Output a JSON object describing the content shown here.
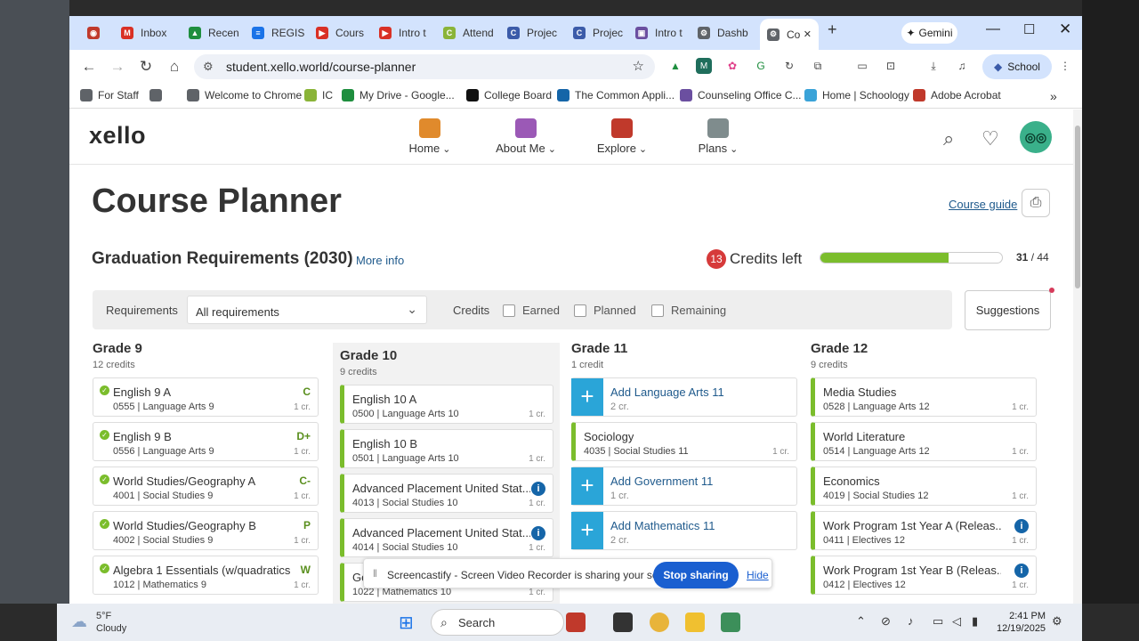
{
  "browser": {
    "tabs": [
      {
        "label": "",
        "color": "#c0392b",
        "glyph": "◉"
      },
      {
        "label": "Inbox",
        "color": "#d93025",
        "glyph": "M"
      },
      {
        "label": "Recen",
        "color": "#1e8e3e",
        "glyph": "▲"
      },
      {
        "label": "REGIS",
        "color": "#1a73e8",
        "glyph": "≡"
      },
      {
        "label": "Cours",
        "color": "#d93025",
        "glyph": "▶"
      },
      {
        "label": "Intro t",
        "color": "#d93025",
        "glyph": "▶"
      },
      {
        "label": "Attend",
        "color": "#8ab438",
        "glyph": "C"
      },
      {
        "label": "Projec",
        "color": "#3b5ba9",
        "glyph": "C"
      },
      {
        "label": "Projec",
        "color": "#3b5ba9",
        "glyph": "C"
      },
      {
        "label": "Intro t",
        "color": "#6b4fa0",
        "glyph": "▣"
      },
      {
        "label": "Dashb",
        "color": "#5f6368",
        "glyph": "⚙"
      },
      {
        "label": "Co",
        "color": "#5f6368",
        "glyph": "⚙"
      }
    ],
    "gemini_label": "Gemini",
    "url": "student.xello.world/course-planner",
    "profile_label": "School",
    "bookmarks": [
      {
        "label": "For Staff",
        "color": "#5f6368"
      },
      {
        "label": "",
        "color": "#5f6368"
      },
      {
        "label": "Welcome to Chrome",
        "color": "#5f6368"
      },
      {
        "label": "IC",
        "color": "#8ab438"
      },
      {
        "label": "My Drive - Google...",
        "color": "#1e8e3e"
      },
      {
        "label": "College Board",
        "color": "#111111"
      },
      {
        "label": "The Common Appli...",
        "color": "#1565a8"
      },
      {
        "label": "Counseling Office C...",
        "color": "#6b4fa0"
      },
      {
        "label": "Home | Schoology",
        "color": "#3aa3d8"
      },
      {
        "label": "Adobe Acrobat",
        "color": "#c0392b"
      }
    ],
    "more_bookmarks": "»"
  },
  "xello": {
    "logo": "xello",
    "nav": [
      {
        "label": "Home",
        "icon": "house-icon",
        "color": "#e08a2c"
      },
      {
        "label": "About Me",
        "icon": "person-icon",
        "color": "#9b59b6"
      },
      {
        "label": "Explore",
        "icon": "rocket-icon",
        "color": "#c0392b"
      },
      {
        "label": "Plans",
        "icon": "clipboard-icon",
        "color": "#7f8c8d"
      }
    ],
    "avatar_glyph": "◎◎"
  },
  "planner": {
    "title": "Course Planner",
    "course_guide": "Course guide",
    "grad_title": "Graduation Requirements (2030)",
    "more_info": "More info",
    "credits_left_num": "13",
    "credits_left_label": "Credits left",
    "progress_earned": "31",
    "progress_total": "/ 44",
    "progress_fraction": 0.7045,
    "filter": {
      "requirements_label": "Requirements",
      "requirements_value": "All requirements",
      "credits_label": "Credits",
      "earned": "Earned",
      "planned": "Planned",
      "remaining": "Remaining"
    },
    "suggestions": "Suggestions"
  },
  "grades": [
    {
      "title": "Grade 9",
      "credits": "12 credits",
      "courses": [
        {
          "name": "English 9 A",
          "code": "0555 | Language Arts 9",
          "credit": "1 cr.",
          "grade": "C",
          "type": "done"
        },
        {
          "name": "English 9 B",
          "code": "0556 | Language Arts 9",
          "credit": "1 cr.",
          "grade": "D+",
          "type": "done"
        },
        {
          "name": "World Studies/Geography A",
          "code": "4001 | Social Studies 9",
          "credit": "1 cr.",
          "grade": "C-",
          "type": "done"
        },
        {
          "name": "World Studies/Geography B",
          "code": "4002 | Social Studies 9",
          "credit": "1 cr.",
          "grade": "P",
          "type": "done"
        },
        {
          "name": "Algebra 1 Essentials (w/quadratics ...",
          "code": "1012 | Mathematics 9",
          "credit": "1 cr.",
          "grade": "W",
          "type": "done"
        }
      ]
    },
    {
      "title": "Grade 10",
      "credits": "9 credits",
      "courses": [
        {
          "name": "English 10 A",
          "code": "0500 | Language Arts 10",
          "credit": "1 cr.",
          "type": "planned"
        },
        {
          "name": "English 10 B",
          "code": "0501 | Language Arts 10",
          "credit": "1 cr.",
          "type": "planned"
        },
        {
          "name": "Advanced Placement United Stat...",
          "code": "4013 | Social Studies 10",
          "credit": "1 cr.",
          "type": "planned-info"
        },
        {
          "name": "Advanced Placement United Stat...",
          "code": "4014 | Social Studies 10",
          "credit": "1 cr.",
          "type": "planned-info"
        },
        {
          "name": "Ge...",
          "code": "1022 | Mathematics 10",
          "credit": "1 cr.",
          "type": "planned"
        }
      ]
    },
    {
      "title": "Grade 11",
      "credits": "1 credit",
      "courses": [
        {
          "name": "Add Language Arts 11",
          "code": "2 cr.",
          "credit": "",
          "type": "add"
        },
        {
          "name": "Sociology",
          "code": "4035 | Social Studies 11",
          "credit": "1 cr.",
          "type": "planned"
        },
        {
          "name": "Add Government 11",
          "code": "1 cr.",
          "credit": "",
          "type": "add"
        },
        {
          "name": "Add Mathematics 11",
          "code": "2 cr.",
          "credit": "",
          "type": "add"
        }
      ]
    },
    {
      "title": "Grade 12",
      "credits": "9 credits",
      "courses": [
        {
          "name": "Media Studies",
          "code": "0528 | Language Arts 12",
          "credit": "1 cr.",
          "type": "planned"
        },
        {
          "name": "World Literature",
          "code": "0514 | Language Arts 12",
          "credit": "1 cr.",
          "type": "planned"
        },
        {
          "name": "Economics",
          "code": "4019 | Social Studies 12",
          "credit": "1 cr.",
          "type": "planned"
        },
        {
          "name": "Work Program 1st Year A (Releas...",
          "code": "0411 | Electives 12",
          "credit": "1 cr.",
          "type": "planned-info"
        },
        {
          "name": "Work Program 1st Year B (Releas...",
          "code": "0412 | Electives 12",
          "credit": "1 cr.",
          "type": "planned-info"
        }
      ]
    }
  ],
  "screenshare": {
    "text": "Screencastify - Screen Video Recorder is sharing your screen.",
    "stop": "Stop sharing",
    "hide": "Hide"
  },
  "taskbar": {
    "temp": "5°F",
    "condition": "Cloudy",
    "search": "Search",
    "time": "2:41 PM",
    "date": "12/19/2025"
  }
}
